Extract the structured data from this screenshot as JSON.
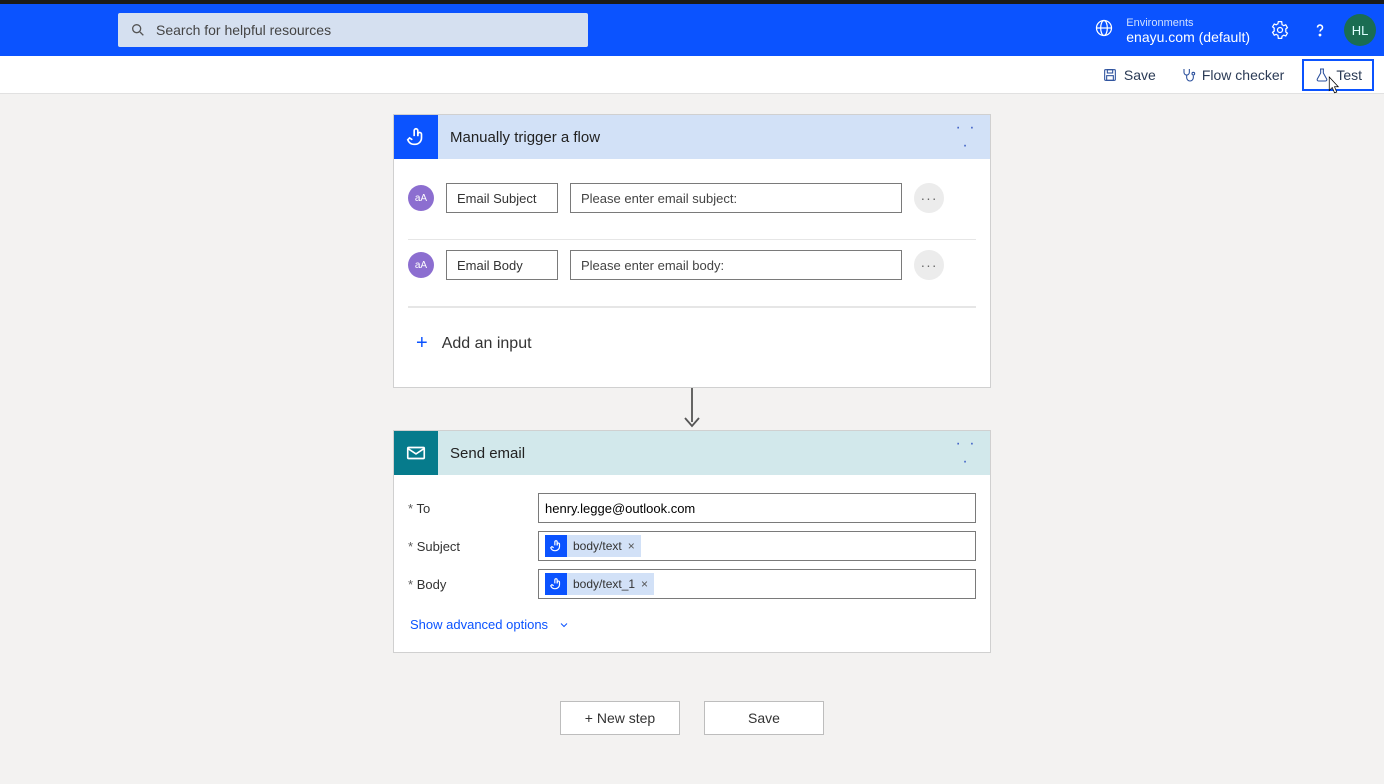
{
  "header": {
    "search_placeholder": "Search for helpful resources",
    "env_label": "Environments",
    "env_value": "enayu.com (default)",
    "avatar": "HL"
  },
  "toolbar": {
    "save": "Save",
    "checker": "Flow checker",
    "test": "Test"
  },
  "trigger": {
    "title": "Manually trigger a flow",
    "params": [
      {
        "name": "Email Subject",
        "placeholder": "Please enter email subject:"
      },
      {
        "name": "Email Body",
        "placeholder": "Please enter email body:"
      }
    ],
    "add_input": "Add an input",
    "badge_text": "aA"
  },
  "send": {
    "title": "Send email",
    "fields": {
      "to_label": "To",
      "to_value": "henry.legge@outlook.com",
      "subject_label": "Subject",
      "subject_token": "body/text",
      "body_label": "Body",
      "body_token": "body/text_1"
    },
    "advanced": "Show advanced options"
  },
  "footer": {
    "new_step": "+ New step",
    "save": "Save"
  }
}
